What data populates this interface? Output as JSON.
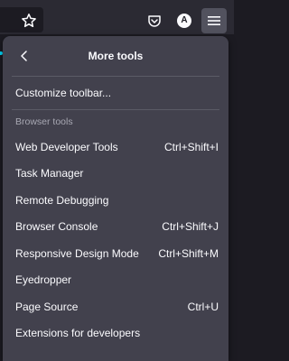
{
  "toolbar": {
    "account_initial": "A",
    "icons": [
      "star-icon",
      "pocket-icon",
      "account-icon",
      "menu-icon"
    ]
  },
  "panel": {
    "title": "More tools",
    "customize_label": "Customize toolbar...",
    "section_label": "Browser tools",
    "items": [
      {
        "label": "Web Developer Tools",
        "shortcut": "Ctrl+Shift+I"
      },
      {
        "label": "Task Manager",
        "shortcut": ""
      },
      {
        "label": "Remote Debugging",
        "shortcut": ""
      },
      {
        "label": "Browser Console",
        "shortcut": "Ctrl+Shift+J"
      },
      {
        "label": "Responsive Design Mode",
        "shortcut": "Ctrl+Shift+M"
      },
      {
        "label": "Eyedropper",
        "shortcut": ""
      },
      {
        "label": "Page Source",
        "shortcut": "Ctrl+U"
      },
      {
        "label": "Extensions for developers",
        "shortcut": ""
      }
    ]
  },
  "colors": {
    "background": "#1c1b22",
    "toolbar": "#2b2a33",
    "panel": "#42414d",
    "active_button": "#52525e",
    "accent": "#00ddff",
    "text": "#fbfbfe",
    "muted_text": "#a8a8b3"
  }
}
